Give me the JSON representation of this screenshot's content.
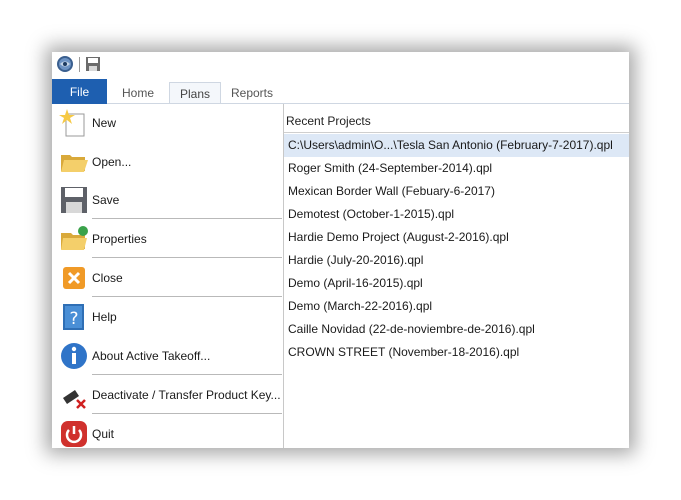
{
  "app": {
    "icons": {
      "app": "app-globe-icon",
      "save": "floppy-save-icon"
    }
  },
  "tabs": {
    "file": "File",
    "home": "Home",
    "plans": "Plans",
    "reports": "Reports"
  },
  "menu": {
    "items": [
      {
        "label": "New",
        "icon": "new-document-icon"
      },
      {
        "label": "Open...",
        "icon": "folder-open-icon"
      },
      {
        "label": "Save",
        "icon": "floppy-save-icon"
      },
      {
        "label": "Properties",
        "icon": "properties-folder-icon"
      },
      {
        "label": "Close",
        "icon": "close-x-icon"
      },
      {
        "label": "Help",
        "icon": "help-book-icon"
      },
      {
        "label": "About Active Takeoff...",
        "icon": "info-icon"
      },
      {
        "label": "Deactivate / Transfer Product Key...",
        "icon": "deactivate-key-icon"
      },
      {
        "label": "Quit",
        "icon": "power-quit-icon"
      }
    ]
  },
  "recent": {
    "title": "Recent Projects",
    "items": [
      "C:\\Users\\admin\\O...\\Tesla San Antonio (February-7-2017).qpl",
      "Roger Smith (24-September-2014).qpl",
      "Mexican Border Wall (Febuary-6-2017)",
      "Demotest (October-1-2015).qpl",
      "Hardie Demo Project (August-2-2016).qpl",
      "Hardie (July-20-2016).qpl",
      "Demo (April-16-2015).qpl",
      "Demo (March-22-2016).qpl",
      "Caille Novidad (22-de-noviembre-de-2016).qpl",
      "CROWN STREET (November-18-2016).qpl"
    ]
  },
  "colors": {
    "file_tab": "#1e5fb0",
    "selected_row": "#dde8f6"
  }
}
